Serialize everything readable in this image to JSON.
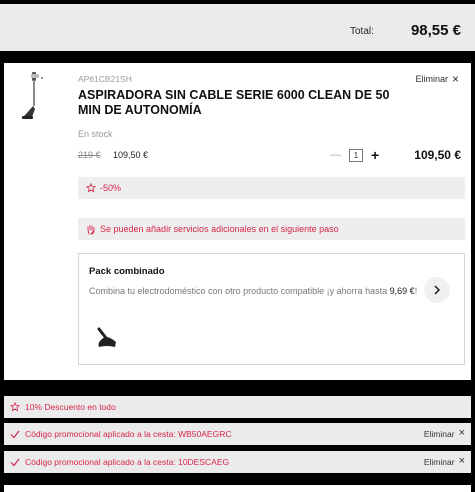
{
  "summary": {
    "total_label": "Total:",
    "total_value": "98,55 €"
  },
  "item": {
    "sku": "AP61CB21SH",
    "remove_label": "Eliminar",
    "name": "ASPIRADORA SIN CABLE SERIE 6000 CLEAN DE 50 MIN DE AUTONOMÍA",
    "stock": "En stock",
    "old_price": "219 €",
    "new_price": "109,50 €",
    "quantity": "1",
    "line_total": "109,50 €",
    "discount_badge": "-50%",
    "services_note": "Se pueden añadir servicios adicionales en el siguiente paso"
  },
  "pack": {
    "title": "Pack combinado",
    "description": "Combina tu electrodoméstico con otro producto compatible ¡y ahorra hasta ",
    "savings": "9,69 €",
    "description_end": "!"
  },
  "promos": [
    {
      "text": "10% Descuento en todo",
      "icon": "tag-icon"
    },
    {
      "text": "Código promocional aplicado a la cesta: WB50AEGRC",
      "icon": "check-icon",
      "remove_label": "Eliminar"
    },
    {
      "text": "Código promocional aplicado a la cesta: 10DESCAEG",
      "icon": "check-icon",
      "remove_label": "Eliminar"
    }
  ],
  "colors": {
    "accent": "#d7264a",
    "panel": "#ebebeb",
    "background": "#000000"
  }
}
